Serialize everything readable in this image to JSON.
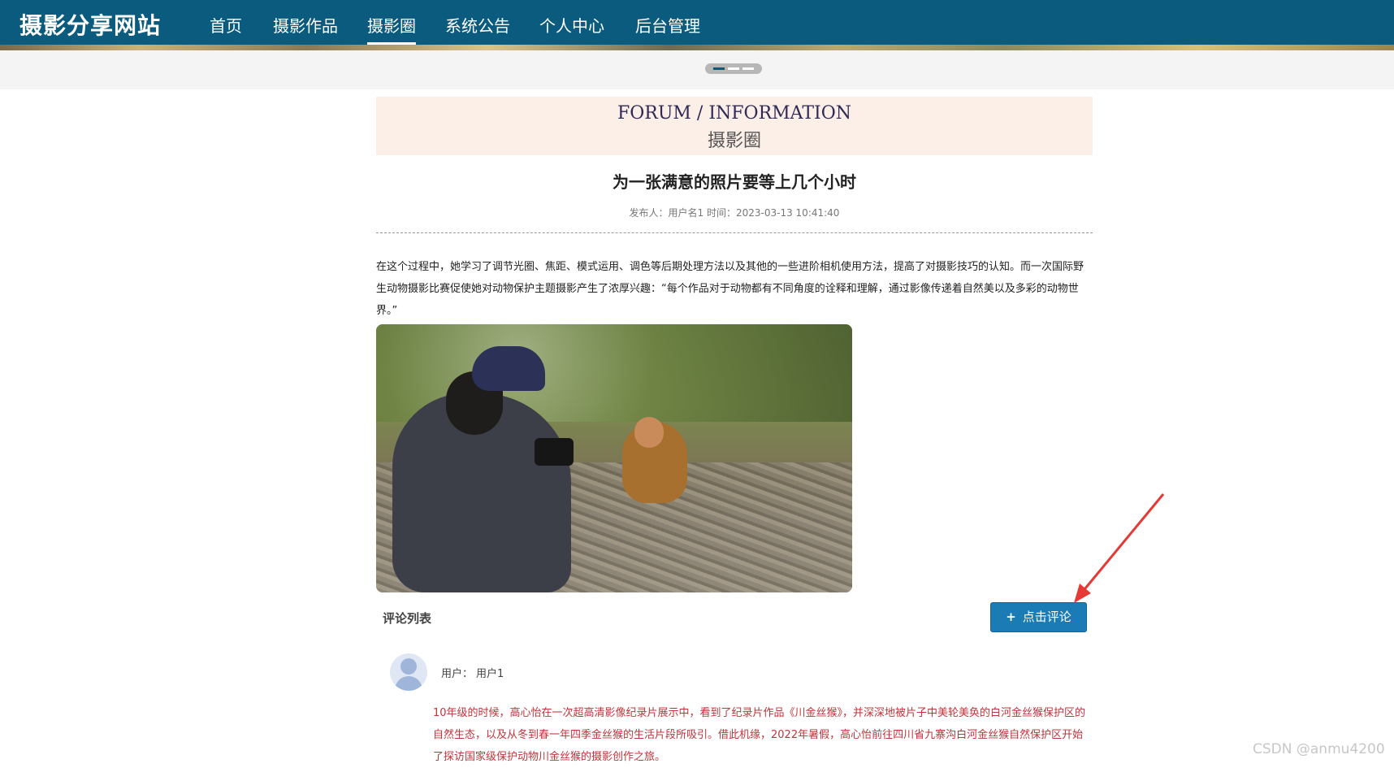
{
  "nav": {
    "brand": "摄影分享网站",
    "items": [
      {
        "label": "首页"
      },
      {
        "label": "摄影作品"
      },
      {
        "label": "摄影圈"
      },
      {
        "label": "系统公告"
      },
      {
        "label": "个人中心"
      },
      {
        "label": "后台管理"
      }
    ],
    "active_index": 2
  },
  "carousel": {
    "slides": 3,
    "active": 0
  },
  "section": {
    "title_en": "FORUM / INFORMATION",
    "title_cn": "摄影圈"
  },
  "article": {
    "title": "为一张满意的照片要等上几个小时",
    "meta": "发布人：用户名1 时间：2023-03-13 10:41:40",
    "content": "在这个过程中，她学习了调节光圈、焦距、模式运用、调色等后期处理方法以及其他的一些进阶相机使用方法，提高了对摄影技巧的认知。而一次国际野生动物摄影比赛促使她对动物保护主题摄影产生了浓厚兴趣：“每个作品对于动物都有不同角度的诠释和理解，通过影像传递着自然美以及多彩的动物世界。”"
  },
  "comments": {
    "label": "评论列表",
    "add_button": "点击评论",
    "items": [
      {
        "user_prefix": "用户：",
        "user": "用户1",
        "text": "10年级的时候，高心怡在一次超高清影像纪录片展示中，看到了纪录片作品《川金丝猴》，并深深地被片子中美轮美奂的白河金丝猴保护区的自然生态，以及从冬到春一年四季金丝猴的生活片段所吸引。借此机缘，2022年暑假，高心怡前往四川省九寨沟白河金丝猴自然保护区开始了探访国家级保护动物川金丝猴的摄影创作之旅。"
      }
    ]
  },
  "watermark": "CSDN @anmu4200",
  "colors": {
    "nav_bg": "#0b5b7e",
    "button": "#1a7bb5",
    "comment_text": "#c0343b",
    "title_box": "#fcefe8",
    "arrow": "#e53935"
  }
}
